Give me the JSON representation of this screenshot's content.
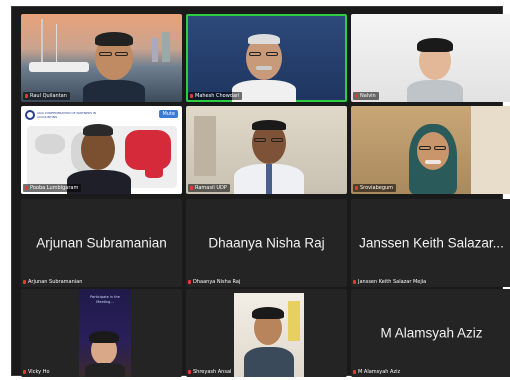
{
  "participants": [
    {
      "name": "Raul Quilantan"
    },
    {
      "name": "Mahesh Chowdari"
    },
    {
      "name": "Nalvin"
    },
    {
      "name": "Pooba Lumbigaram"
    },
    {
      "name": "Ramasil UDP"
    },
    {
      "name": "Sroviabegum"
    },
    {
      "name": "Arjunan Subramanian",
      "display": "Arjunan Subramanian"
    },
    {
      "name": "Dhaanya Nisha Raj",
      "display": "Dhaanya Nisha Raj"
    },
    {
      "name": "Janssen Keith Salazar Mejia",
      "display": "Janssen Keith Salazar..."
    },
    {
      "name": "Vicky Ho"
    },
    {
      "name": "Shreyash Ansal"
    },
    {
      "name": "M Alamsyah Aziz",
      "display": "M Alamsyah Aziz"
    }
  ],
  "slide_logo_text": "ACPA",
  "slide_logo_caption": "ASIA CONFEDERATION OF PARTNERS IN ACCOUNTING",
  "slide_badge": "Mute",
  "phone_text": "Participate in the Meeting...",
  "colors": {
    "active_border": "#2ecc40",
    "mic_muted": "#e53935",
    "grid_bg": "#1a1a1a"
  },
  "icons": {
    "mic": "mic-muted-icon"
  }
}
